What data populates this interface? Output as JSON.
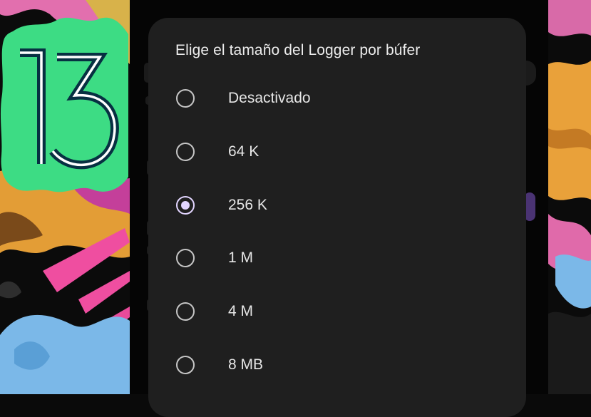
{
  "badge": {
    "text": "13"
  },
  "dialog": {
    "title": "Elige el tamaño del Logger por búfer",
    "options": [
      {
        "label": "Desactivado",
        "selected": false
      },
      {
        "label": "64 K",
        "selected": false
      },
      {
        "label": "256 K",
        "selected": true
      },
      {
        "label": "1 M",
        "selected": false
      },
      {
        "label": "4 M",
        "selected": false
      },
      {
        "label": "8 MB",
        "selected": false
      }
    ]
  },
  "colors": {
    "dialog_bg": "#1f1f1f",
    "badge_green": "#3ddc84",
    "badge_dark": "#073042",
    "radio_selected": "#e2d5ff",
    "radio_unselected": "#c6c6c6"
  }
}
